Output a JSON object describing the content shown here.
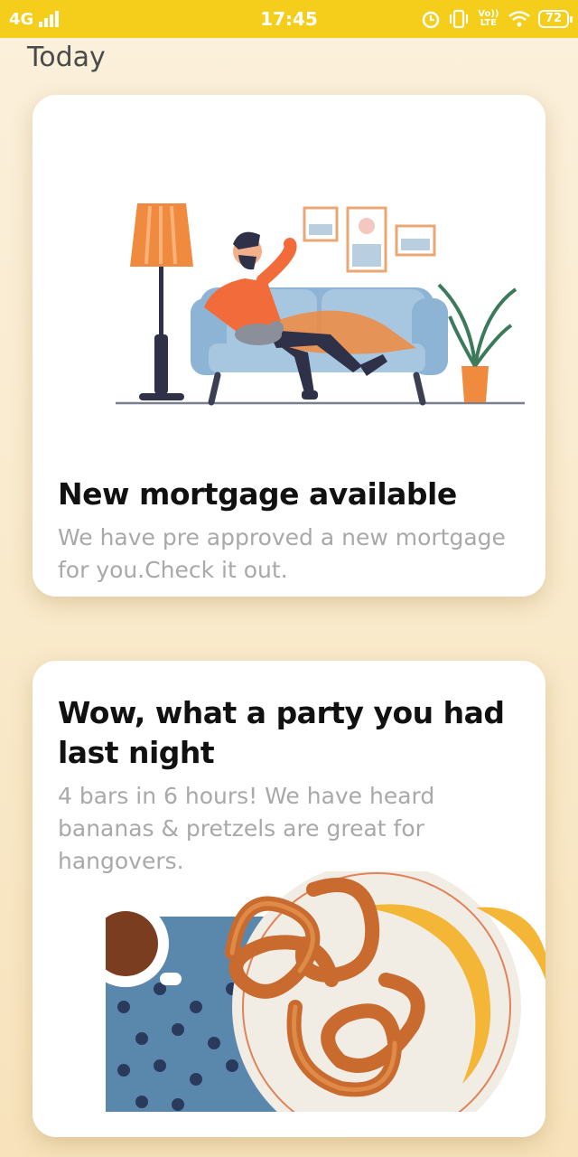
{
  "status_bar": {
    "network": "4G",
    "time": "17:45",
    "volte": "Vo)) LTE",
    "battery": "72"
  },
  "section_title": "Today",
  "cards": [
    {
      "title": "New mortgage available",
      "body": "We have pre approved a new mortgage for you.Check it out.",
      "illustration": "man-relaxing-on-sofa"
    },
    {
      "title": "Wow, what a party you had last night",
      "body": "4 bars in 6 hours! We have heard bananas & pretzels are great for hangovers.",
      "illustration": "pretzels-banana-coffee"
    }
  ],
  "colors": {
    "status_bar": "#f5ce1c",
    "background": "#fbf0dc",
    "card": "#ffffff",
    "title_text": "#111111",
    "body_text": "#a9a9a9"
  }
}
